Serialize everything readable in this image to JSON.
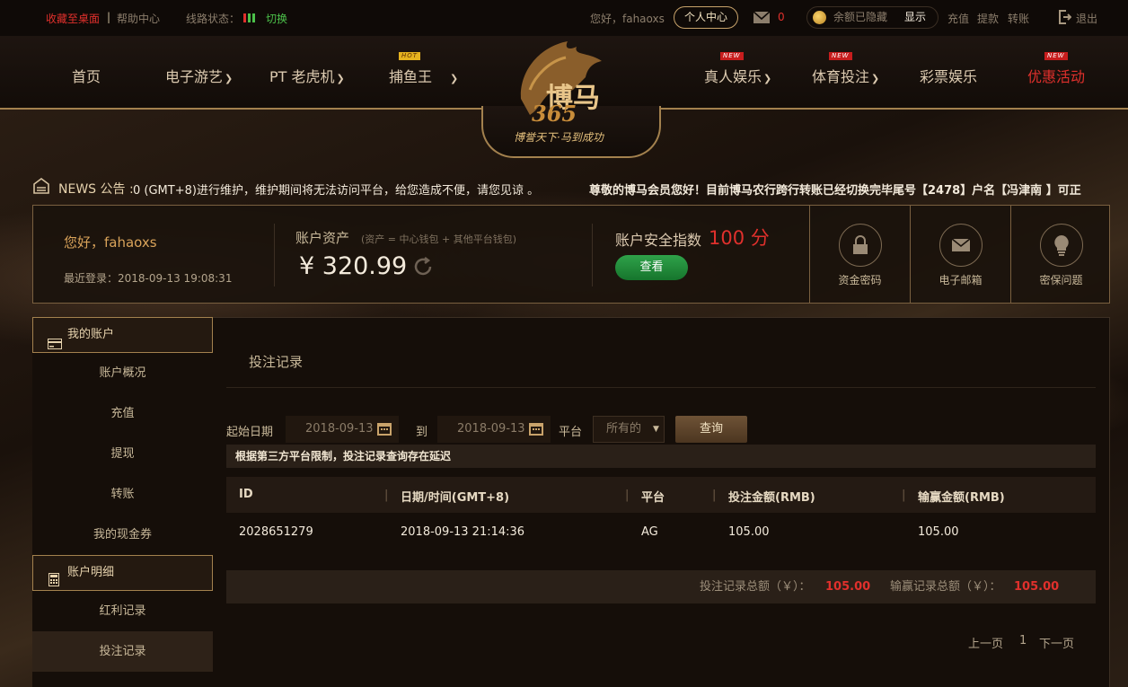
{
  "topbar": {
    "favorite": "收藏至桌面",
    "divider": "|",
    "help": "帮助中心",
    "line_status_label": "线路状态：",
    "switch": "切换",
    "greeting": "您好，fahaoxs",
    "personal_center": "个人中心",
    "mail_count": "0",
    "balance_hidden": "余额已隐藏",
    "show": "显示",
    "deposit": "充值",
    "withdraw": "提款",
    "transfer": "转账",
    "logout": "退出"
  },
  "nav": {
    "items": [
      {
        "label": "首页"
      },
      {
        "label": "电子游艺"
      },
      {
        "label": "PT 老虎机"
      },
      {
        "label": "捕鱼王"
      },
      {
        "label": "真人娱乐"
      },
      {
        "label": "体育投注"
      },
      {
        "label": "彩票娱乐"
      },
      {
        "label": "优惠活动"
      }
    ],
    "badge_hot": "HOT",
    "badge_new": "NEW",
    "logo_text": "博马",
    "logo_number": "365",
    "logo_slogan": "博誉天下·马到成功"
  },
  "news": {
    "label": "NEWS 公告 :",
    "message1": "0 (GMT+8)进行维护，维护期间将无法访问平台，给您造成不便，请您见谅 。",
    "message2": "尊敬的博马会员您好！目前博马农行跨行转账已经切换完毕尾号【2478】户名【冯津南 】可正"
  },
  "account": {
    "hello": "您好，fahaoxs",
    "last_login": "最近登录：2018-09-13 19:08:31",
    "assets_label": "账户资产",
    "assets_note": "(资产 = 中心钱包 + 其他平台钱包)",
    "assets_value": "¥ 320.99",
    "security_label": "账户安全指数",
    "security_score": "100 分",
    "check_button": "查看",
    "security_items": [
      {
        "label": "资金密码",
        "icon": "lock-icon"
      },
      {
        "label": "电子邮箱",
        "icon": "mail-icon"
      },
      {
        "label": "密保问题",
        "icon": "bulb-icon"
      }
    ]
  },
  "sidebar": {
    "section1": "我的账户",
    "items1": [
      "账户概况",
      "充值",
      "提现",
      "转账",
      "我的现金券"
    ],
    "section2": "账户明细",
    "items2": [
      "红利记录",
      "投注记录"
    ]
  },
  "main": {
    "title": "投注记录",
    "start_date_label": "起始日期",
    "start_date": "2018-09-13",
    "to": "到",
    "end_date": "2018-09-13",
    "platform_label": "平台",
    "platform_value": "所有的",
    "query_button": "查询",
    "notice": "根据第三方平台限制，投注记录查询存在延迟",
    "columns": [
      "ID",
      "日期/时间(GMT+8)",
      "平台",
      "投注金额(RMB)",
      "输赢金额(RMB)"
    ],
    "rows": [
      [
        "2028651279",
        "2018-09-13 21:14:36",
        "AG",
        "105.00",
        "105.00"
      ]
    ],
    "summary_bet_label": "投注记录总额（￥）：",
    "summary_bet": "105.00",
    "summary_win_label": "输赢记录总额（￥）：",
    "summary_win": "105.00",
    "prev": "上一页",
    "page": "1",
    "next": "下一页"
  },
  "colors": {
    "accent_red": "#e0302c",
    "gold": "#a3814e",
    "green": "#16752c"
  }
}
